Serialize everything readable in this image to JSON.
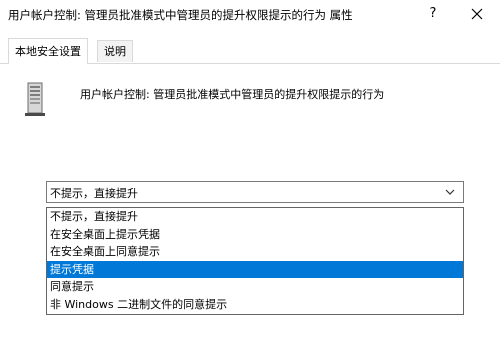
{
  "window": {
    "title": "用户帐户控制: 管理员批准模式中管理员的提升权限提示的行为 属性",
    "help_label": "?",
    "close_icon": "close-icon"
  },
  "tabs": [
    {
      "label": "本地安全设置",
      "active": true
    },
    {
      "label": "说明",
      "active": false
    }
  ],
  "policy": {
    "icon": "server-icon",
    "name": "用户帐户控制: 管理员批准模式中管理员的提升权限提示的行为"
  },
  "combo": {
    "value": "不提示，直接提升",
    "arrow_icon": "chevron-down-icon"
  },
  "dropdown": {
    "options": [
      {
        "label": "不提示，直接提升",
        "selected": false
      },
      {
        "label": "在安全桌面上提示凭据",
        "selected": false
      },
      {
        "label": "在安全桌面上同意提示",
        "selected": false
      },
      {
        "label": "提示凭据",
        "selected": true
      },
      {
        "label": "同意提示",
        "selected": false
      },
      {
        "label": "非 Windows 二进制文件的同意提示",
        "selected": false
      }
    ]
  },
  "colors": {
    "selection": "#0078d7",
    "tab_border": "#d9d9d9",
    "combo_border": "#7a7a7a"
  }
}
